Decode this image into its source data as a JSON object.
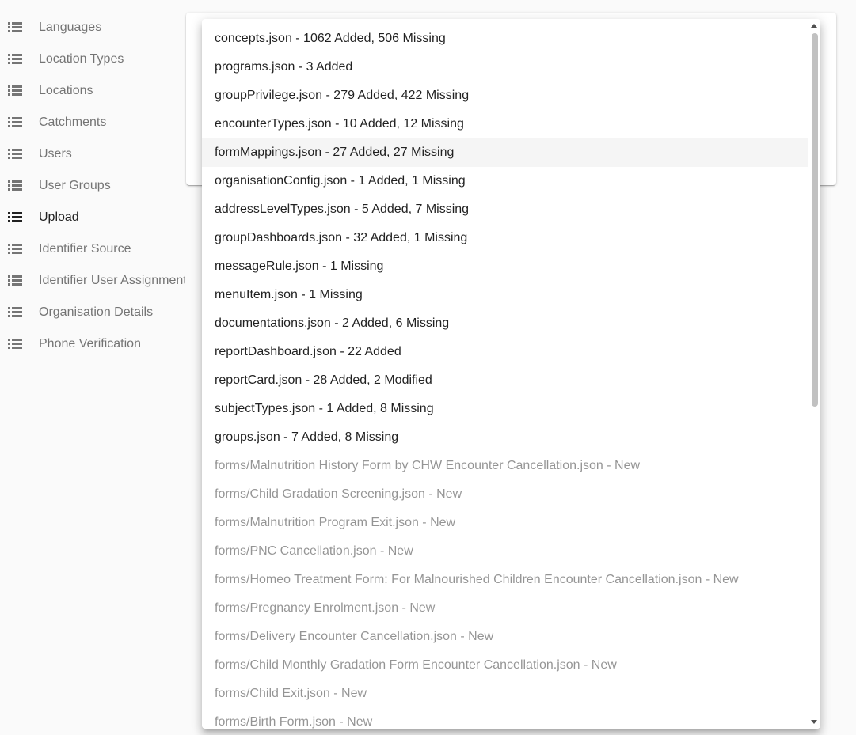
{
  "sidebar": {
    "items": [
      {
        "label": "Languages",
        "active": false
      },
      {
        "label": "Location Types",
        "active": false
      },
      {
        "label": "Locations",
        "active": false
      },
      {
        "label": "Catchments",
        "active": false
      },
      {
        "label": "Users",
        "active": false
      },
      {
        "label": "User Groups",
        "active": false
      },
      {
        "label": "Upload",
        "active": true
      },
      {
        "label": "Identifier Source",
        "active": false
      },
      {
        "label": "Identifier User Assignment",
        "active": false
      },
      {
        "label": "Organisation Details",
        "active": false
      },
      {
        "label": "Phone Verification",
        "active": false
      }
    ],
    "icon": "list-icon"
  },
  "dropdown": {
    "items": [
      {
        "label": "concepts.json - 1062 Added, 506 Missing",
        "state": "changed"
      },
      {
        "label": "programs.json - 3 Added",
        "state": "changed"
      },
      {
        "label": "groupPrivilege.json - 279 Added, 422 Missing",
        "state": "changed"
      },
      {
        "label": "encounterTypes.json - 10 Added, 12 Missing",
        "state": "changed"
      },
      {
        "label": "formMappings.json - 27 Added, 27 Missing",
        "state": "changed",
        "highlighted": true
      },
      {
        "label": "organisationConfig.json - 1 Added, 1 Missing",
        "state": "changed"
      },
      {
        "label": "addressLevelTypes.json - 5 Added, 7 Missing",
        "state": "changed"
      },
      {
        "label": "groupDashboards.json - 32 Added, 1 Missing",
        "state": "changed"
      },
      {
        "label": "messageRule.json - 1 Missing",
        "state": "changed"
      },
      {
        "label": "menuItem.json - 1 Missing",
        "state": "changed"
      },
      {
        "label": "documentations.json - 2 Added, 6 Missing",
        "state": "changed"
      },
      {
        "label": "reportDashboard.json - 22 Added",
        "state": "changed"
      },
      {
        "label": "reportCard.json - 28 Added, 2 Modified",
        "state": "changed"
      },
      {
        "label": "subjectTypes.json - 1 Added, 8 Missing",
        "state": "changed"
      },
      {
        "label": "groups.json - 7 Added, 8 Missing",
        "state": "changed"
      },
      {
        "label": "forms/Malnutrition History Form by CHW Encounter Cancellation.json - New",
        "state": "new"
      },
      {
        "label": "forms/Child Gradation Screening.json - New",
        "state": "new"
      },
      {
        "label": "forms/Malnutrition Program Exit.json - New",
        "state": "new"
      },
      {
        "label": "forms/PNC Cancellation.json - New",
        "state": "new"
      },
      {
        "label": "forms/Homeo Treatment Form: For Malnourished Children Encounter Cancellation.json - New",
        "state": "new"
      },
      {
        "label": "forms/Pregnancy Enrolment.json - New",
        "state": "new"
      },
      {
        "label": "forms/Delivery Encounter Cancellation.json - New",
        "state": "new"
      },
      {
        "label": "forms/Child Monthly Gradation Form Encounter Cancellation.json - New",
        "state": "new"
      },
      {
        "label": "forms/Child Exit.json - New",
        "state": "new"
      },
      {
        "label": "forms/Birth Form.json - New",
        "state": "new"
      }
    ]
  },
  "colors": {
    "sidebar_text": "#757575",
    "sidebar_active_text": "#212121",
    "item_text": "#212121",
    "new_item_text": "#9e9e9e",
    "highlight_bg": "#f5f5f5",
    "background": "#fafafa"
  }
}
